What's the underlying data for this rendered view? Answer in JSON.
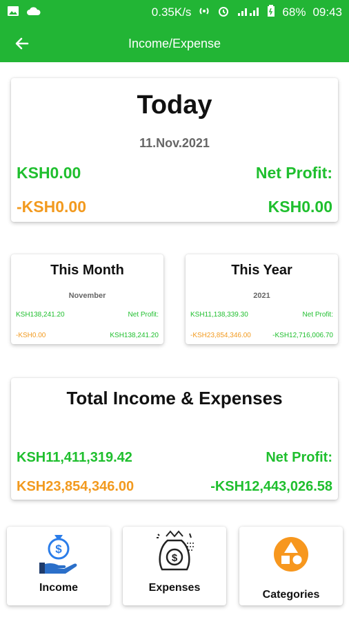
{
  "status_bar": {
    "speed": "0.35K/s",
    "battery": "68%",
    "time": "09:43",
    "icons": [
      "image-icon",
      "cloud-icon",
      "hotspot-icon",
      "alarm-icon",
      "signal-icon",
      "battery-icon"
    ]
  },
  "app_bar": {
    "title": "Income/Expense",
    "back_icon": "arrow-left-icon"
  },
  "today": {
    "title": "Today",
    "date": "11.Nov.2021",
    "income": "KSH0.00",
    "net_profit_label": "Net Profit:",
    "expense": "-KSH0.00",
    "net_profit": "KSH0.00"
  },
  "month": {
    "title": "This Month",
    "period": "November",
    "income": "KSH138,241.20",
    "net_profit_label": "Net Profit:",
    "expense": "-KSH0.00",
    "net_profit": "KSH138,241.20"
  },
  "year": {
    "title": "This Year",
    "period": "2021",
    "income": "KSH11,138,339.30",
    "net_profit_label": "Net Profit:",
    "expense": "-KSH23,854,346.00",
    "net_profit": "-KSH12,716,006.70"
  },
  "total": {
    "title": "Total Income & Expenses",
    "income": "KSH11,411,319.42",
    "net_profit_label": "Net Profit:",
    "expense": "KSH23,854,346.00",
    "net_profit": "-KSH12,443,026.58"
  },
  "buttons": {
    "income": "Income",
    "expenses": "Expenses",
    "categories": "Categories"
  },
  "colors": {
    "primary": "#22b535",
    "income_text": "#1fbf2e",
    "expense_text": "#f29a1f"
  }
}
